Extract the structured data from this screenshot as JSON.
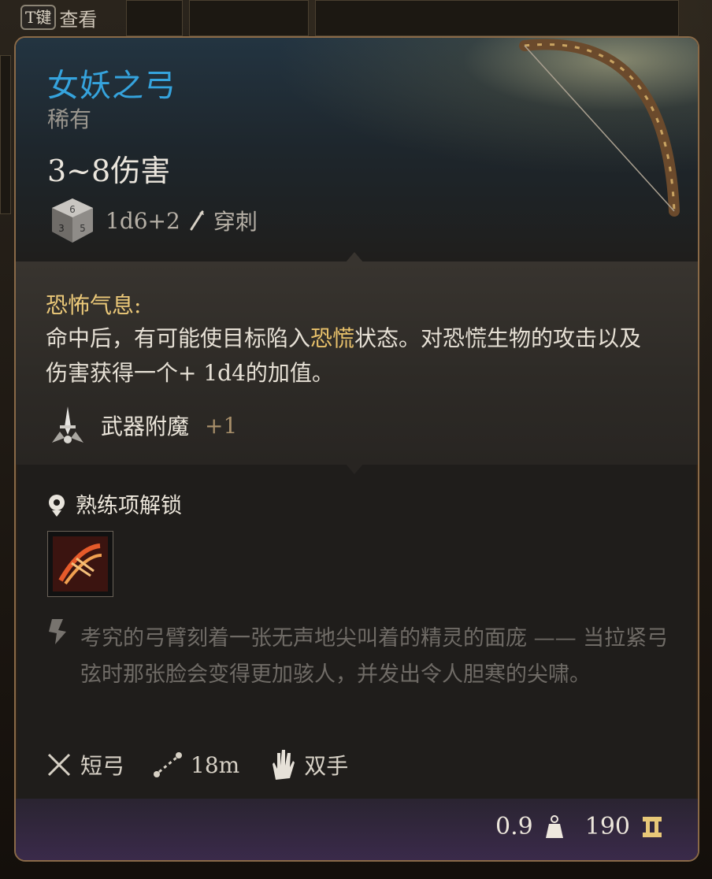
{
  "hint": {
    "key": "T键",
    "label": "查看"
  },
  "item": {
    "name": "女妖之弓",
    "rarity": "稀有",
    "damage": "3~8伤害",
    "dice": "1d6+2",
    "damage_type": "穿刺"
  },
  "passive": {
    "title": "恐怖气息:",
    "body_part1": "命中后，有可能使目标陷入",
    "body_highlight": "恐慌",
    "body_part2": "状态。对恐慌生物的攻击以及伤害获得一个+ 1d4的加值。"
  },
  "enchant": {
    "label": "武器附魔",
    "value": "+1"
  },
  "proficiency": {
    "label": "熟练项解锁"
  },
  "lore": "考究的弓臂刻着一张无声地尖叫着的精灵的面庞 —— 当拉紧弓弦时那张脸会变得更加骇人，并发出令人胆寒的尖啸。",
  "stats": {
    "weapon_type": "短弓",
    "range": "18m",
    "handedness": "双手"
  },
  "footer": {
    "weight": "0.9",
    "price": "190"
  },
  "colors": {
    "title": "#35a3dd",
    "highlight": "#e8c16a",
    "border": "#8a6a48"
  },
  "icons": {
    "dice": "d6-dice-icon",
    "damage_type": "piercing-arrow-icon",
    "enchant": "sword-enchant-icon",
    "proficiency": "proficiency-gear-icon",
    "proficiency_skill": "bow-proficiency-icon",
    "lore": "quill-lore-icon",
    "weapon_type": "crossed-swords-icon",
    "range": "range-dotted-line-icon",
    "handedness": "hand-icon",
    "weight": "weight-icon",
    "price": "gold-coin-icon"
  }
}
